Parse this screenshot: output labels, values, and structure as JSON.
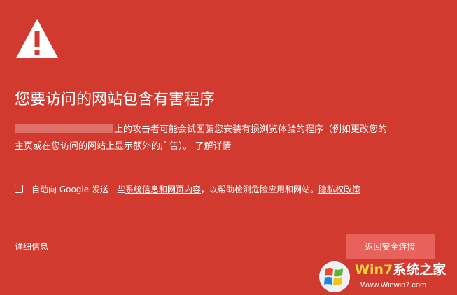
{
  "interstitial": {
    "headline": "您要访问的网站包含有害程序",
    "description_line1": "上的攻击者可能会试图骗您安装有损浏览体验的程序（例如更改您的",
    "description_line2": "主页或在您访问的网站上显示额外的广告）。",
    "learn_more_link": "了解详情",
    "optin": {
      "checked": false,
      "text_before": "自动向 Google 发送一些",
      "link_system_info": "系统信息和网页内容",
      "text_middle": "，以帮助检测危险应用和网站。",
      "link_privacy": "隐私权政策"
    },
    "details_link": "详细信息",
    "back_button": "返回安全连接",
    "colors": {
      "background": "#d23a2f",
      "button": "#e8615b",
      "text": "#ffffff"
    },
    "icon": "warning-triangle-icon"
  },
  "watermark": {
    "brand_part1": "Win7",
    "brand_part2": "系统之家",
    "url": "Www.Winwin7.com"
  }
}
